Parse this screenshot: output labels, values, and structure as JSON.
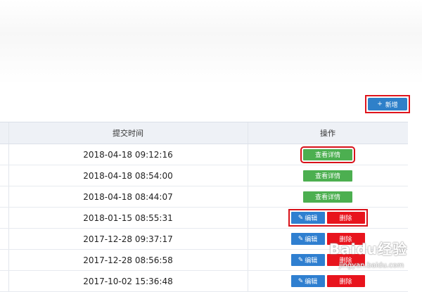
{
  "toolbar": {
    "add_label": "新增",
    "add_icon": "plus-icon"
  },
  "table": {
    "headers": {
      "time": "提交时间",
      "ops": "操作"
    },
    "rows": [
      {
        "time": "2018-04-18 09:12:16",
        "type": "detail",
        "detail": "查看详情"
      },
      {
        "time": "2018-04-18 08:54:00",
        "type": "detail",
        "detail": "查看详情"
      },
      {
        "time": "2018-04-18 08:44:07",
        "type": "detail",
        "detail": "查看详情"
      },
      {
        "time": "2018-01-15 08:55:31",
        "type": "edit",
        "edit": "编辑",
        "delete": "删除"
      },
      {
        "time": "2017-12-28 09:37:17",
        "type": "edit",
        "edit": "编辑",
        "delete": "删除"
      },
      {
        "time": "2017-12-28 08:56:58",
        "type": "edit",
        "edit": "编辑",
        "delete": "删除"
      },
      {
        "time": "2017-10-02 15:36:48",
        "type": "edit",
        "edit": "编辑",
        "delete": "删除"
      }
    ]
  },
  "watermark": {
    "brand": "Baidu经验",
    "url": "jingyan.baidu.com"
  },
  "colors": {
    "primary": "#2f80c9",
    "success": "#4caf50",
    "danger": "#e8141d",
    "highlight": "#d8121a",
    "header_bg": "#eef1f6"
  }
}
